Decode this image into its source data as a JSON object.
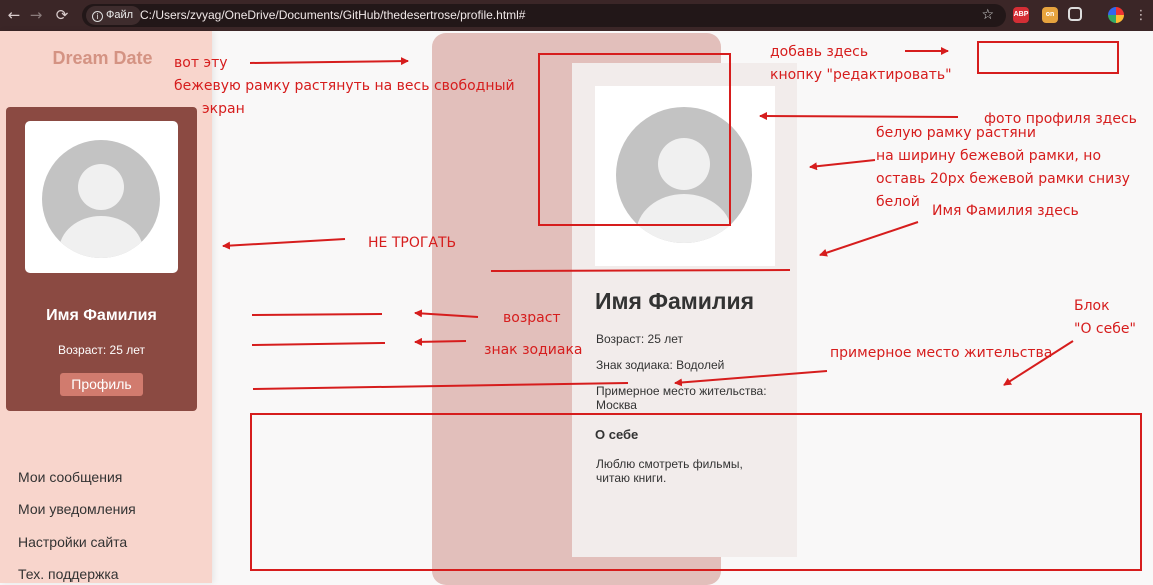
{
  "browser": {
    "back_icon": "←",
    "forward_icon": "→",
    "reload_icon": "⟳",
    "file_chip": "Файл",
    "url": "C:/Users/zvyag/OneDrive/Documents/GitHub/thedesertrose/profile.html#",
    "extensions": [
      {
        "name": "adblock-plus",
        "label": "ABP",
        "color": "#d42e35"
      },
      {
        "name": "extension-on",
        "label": "on",
        "color": "#e6a33e"
      }
    ]
  },
  "sidebar": {
    "logo": "Dream Date",
    "card": {
      "name": "Имя Фамилия",
      "age": "Возраст: 25 лет",
      "button": "Профиль"
    },
    "menu": [
      "Мои сообщения",
      "Мои уведомления",
      "Настройки сайта",
      "Тех. поддержка"
    ]
  },
  "profile": {
    "name": "Имя Фамилия",
    "age": "Возраст: 25 лет",
    "zodiac": "Знак зодиака: Водолей",
    "location_line1": "Примерное место жительства:",
    "location_line2": "Москва",
    "about_title": "О себе",
    "about_line1": "Люблю смотреть фильмы,",
    "about_line2": "читаю книги."
  },
  "annotations": {
    "frame_line1": "вот эту",
    "frame_line2": "бежевую рамку растянуть на весь свободный",
    "frame_line3": "экран",
    "edit_line1": "добавь здесь",
    "edit_line2": "кнопку \"редактировать\"",
    "photo": "фото профиля здесь",
    "white_line1": "белую рамку растяни",
    "white_line2": "на ширину бежевой рамки, но",
    "white_line3": "оставь 20px бежевой рамки снизу",
    "white_line4": "белой",
    "name_here": "Имя Фамилия здесь",
    "dont_touch": "НЕ ТРОГАТЬ",
    "age": "возраст",
    "zodiac": "знак зодиака",
    "block_line1": "Блок",
    "block_line2": "\"О себе\"",
    "location": "примерное место жительства",
    "color": "#d61d1d"
  },
  "colors": {
    "sidebar": "#f8d5cc",
    "card": "#8b4a42",
    "beige_frame": "#e2bfbb",
    "profile_column": "#f2eceb",
    "profile_button": "#d17b6e"
  }
}
